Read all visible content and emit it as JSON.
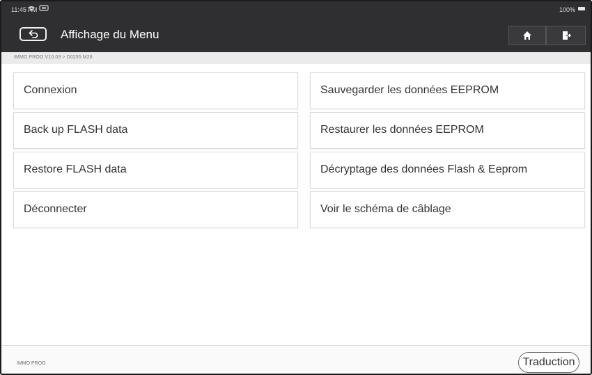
{
  "status_bar": {
    "time": "11:45 AM",
    "battery": "100%"
  },
  "header": {
    "title": "Affichage du Menu",
    "icons": {
      "back": "back-arrow-icon",
      "home": "home-icon",
      "exit": "exit-icon",
      "wifi": "wifi-icon",
      "vci": "vci-icon",
      "battery": "battery-icon"
    }
  },
  "breadcrumb": "IMMO PROG V10.03 > D0255 M28",
  "menu": {
    "left": [
      {
        "label": "Connexion"
      },
      {
        "label": "Back up FLASH data"
      },
      {
        "label": "Restore FLASH data"
      },
      {
        "label": "Déconnecter"
      }
    ],
    "right": [
      {
        "label": "Sauvegarder les données EEPROM"
      },
      {
        "label": "Restaurer les données EEPROM"
      },
      {
        "label": "Décryptage des données Flash & Eeprom"
      },
      {
        "label": "Voir le schéma de câblage"
      }
    ]
  },
  "footer": {
    "label": "IMMO PROG",
    "translate_button": "Traduction"
  },
  "colors": {
    "header_bg": "#2f2f31",
    "breadcrumb_bg": "#ebebeb",
    "page_bg": "#ffffff"
  }
}
